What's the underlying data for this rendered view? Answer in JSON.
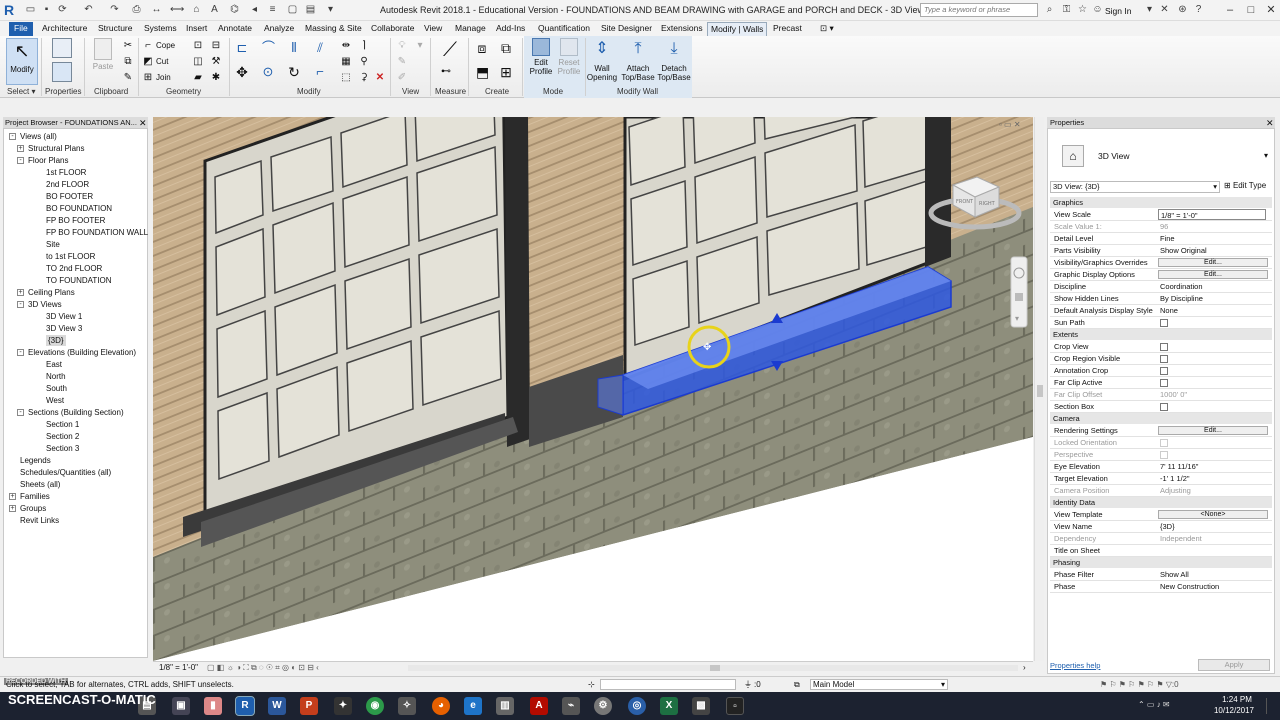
{
  "window": {
    "title": "Autodesk Revit 2018.1 - Educational Version -    FOUNDATIONS AND BEAM DRAWING with GARAGE and PORCH and DECK - 3D View: {3D}",
    "search_placeholder": "Type a keyword or phrase",
    "sign_in": "Sign In"
  },
  "menu_tabs": [
    "File",
    "Architecture",
    "Structure",
    "Systems",
    "Insert",
    "Annotate",
    "Analyze",
    "Massing & Site",
    "Collaborate",
    "View",
    "Manage",
    "Add-Ins",
    "Quantification",
    "Site Designer",
    "Extensions",
    "Modify | Walls",
    "Precast"
  ],
  "ribbon": {
    "modify": "Modify",
    "select": "Select",
    "properties": "Properties",
    "clipboard": "Clipboard",
    "paste": "Paste",
    "cope": "Cope",
    "cut": "Cut",
    "join": "Join",
    "geometry": "Geometry",
    "modify_panel": "Modify",
    "view": "View",
    "measure": "Measure",
    "create": "Create",
    "edit_profile_1": "Edit",
    "edit_profile_2": "Profile",
    "reset_profile_1": "Reset",
    "reset_profile_2": "Profile",
    "mode": "Mode",
    "wall_opening_1": "Wall",
    "wall_opening_2": "Opening",
    "attach_1": "Attach",
    "attach_2": "Top/Base",
    "detach_1": "Detach",
    "detach_2": "Top/Base",
    "modify_wall": "Modify Wall"
  },
  "project_browser": {
    "header": "Project Browser - FOUNDATIONS AN...",
    "items": [
      {
        "label": "Views (all)",
        "level": 0,
        "toggle": "-"
      },
      {
        "label": "Structural Plans",
        "level": 1,
        "toggle": "+"
      },
      {
        "label": "Floor Plans",
        "level": 1,
        "toggle": "-"
      },
      {
        "label": "1st FLOOR",
        "level": 2,
        "toggle": ""
      },
      {
        "label": "2nd FLOOR",
        "level": 2,
        "toggle": ""
      },
      {
        "label": "BO FOOTER",
        "level": 2,
        "toggle": ""
      },
      {
        "label": "BO FOUNDATION",
        "level": 2,
        "toggle": ""
      },
      {
        "label": "FP BO FOOTER",
        "level": 2,
        "toggle": ""
      },
      {
        "label": "FP BO FOUNDATION WALL",
        "level": 2,
        "toggle": ""
      },
      {
        "label": "Site",
        "level": 2,
        "toggle": ""
      },
      {
        "label": "to 1st FLOOR",
        "level": 2,
        "toggle": ""
      },
      {
        "label": "TO 2nd FLOOR",
        "level": 2,
        "toggle": ""
      },
      {
        "label": "TO FOUNDATION",
        "level": 2,
        "toggle": ""
      },
      {
        "label": "Ceiling Plans",
        "level": 1,
        "toggle": "+"
      },
      {
        "label": "3D Views",
        "level": 1,
        "toggle": "-"
      },
      {
        "label": "3D View 1",
        "level": 2,
        "toggle": ""
      },
      {
        "label": "3D View 3",
        "level": 2,
        "toggle": ""
      },
      {
        "label": "{3D}",
        "level": 2,
        "toggle": "",
        "selected": true
      },
      {
        "label": "Elevations (Building Elevation)",
        "level": 1,
        "toggle": "-"
      },
      {
        "label": "East",
        "level": 2,
        "toggle": ""
      },
      {
        "label": "North",
        "level": 2,
        "toggle": ""
      },
      {
        "label": "South",
        "level": 2,
        "toggle": ""
      },
      {
        "label": "West",
        "level": 2,
        "toggle": ""
      },
      {
        "label": "Sections (Building Section)",
        "level": 1,
        "toggle": "-"
      },
      {
        "label": "Section 1",
        "level": 2,
        "toggle": ""
      },
      {
        "label": "Section 2",
        "level": 2,
        "toggle": ""
      },
      {
        "label": "Section 3",
        "level": 2,
        "toggle": ""
      },
      {
        "label": "Legends",
        "level": 0,
        "toggle": ""
      },
      {
        "label": "Schedules/Quantities (all)",
        "level": 0,
        "toggle": ""
      },
      {
        "label": "Sheets (all)",
        "level": 0,
        "toggle": ""
      },
      {
        "label": "Families",
        "level": 0,
        "toggle": "+"
      },
      {
        "label": "Groups",
        "level": 0,
        "toggle": "+"
      },
      {
        "label": "Revit Links",
        "level": 0,
        "toggle": ""
      }
    ]
  },
  "properties": {
    "header": "Properties",
    "type_name": "3D View",
    "selector": "3D View: {3D}",
    "edit_type": "Edit Type",
    "help_link": "Properties help",
    "apply": "Apply",
    "groups": [
      {
        "name": "Graphics",
        "rows": [
          {
            "label": "View Scale",
            "value": "1/8\" = 1'-0\"",
            "kind": "input"
          },
          {
            "label": "Scale Value    1:",
            "value": "96",
            "kind": "grey"
          },
          {
            "label": "Detail Level",
            "value": "Fine"
          },
          {
            "label": "Parts Visibility",
            "value": "Show Original"
          },
          {
            "label": "Visibility/Graphics Overrides",
            "value": "Edit...",
            "kind": "button"
          },
          {
            "label": "Graphic Display Options",
            "value": "Edit...",
            "kind": "button"
          },
          {
            "label": "Discipline",
            "value": "Coordination"
          },
          {
            "label": "Show Hidden Lines",
            "value": "By Discipline"
          },
          {
            "label": "Default Analysis Display Style",
            "value": "None"
          },
          {
            "label": "Sun Path",
            "value": "",
            "kind": "check"
          }
        ]
      },
      {
        "name": "Extents",
        "rows": [
          {
            "label": "Crop View",
            "value": "",
            "kind": "check"
          },
          {
            "label": "Crop Region Visible",
            "value": "",
            "kind": "check"
          },
          {
            "label": "Annotation Crop",
            "value": "",
            "kind": "check"
          },
          {
            "label": "Far Clip Active",
            "value": "",
            "kind": "check"
          },
          {
            "label": "Far Clip Offset",
            "value": "1000' 0\"",
            "kind": "grey"
          },
          {
            "label": "Section Box",
            "value": "",
            "kind": "check"
          }
        ]
      },
      {
        "name": "Camera",
        "rows": [
          {
            "label": "Rendering Settings",
            "value": "Edit...",
            "kind": "button"
          },
          {
            "label": "Locked Orientation",
            "value": "",
            "kind": "greycheck"
          },
          {
            "label": "Perspective",
            "value": "",
            "kind": "greycheck"
          },
          {
            "label": "Eye Elevation",
            "value": "7'  11 11/16\""
          },
          {
            "label": "Target Elevation",
            "value": "-1'  1 1/2\""
          },
          {
            "label": "Camera Position",
            "value": "Adjusting",
            "kind": "grey"
          }
        ]
      },
      {
        "name": "Identity Data",
        "rows": [
          {
            "label": "View Template",
            "value": "<None>",
            "kind": "button"
          },
          {
            "label": "View Name",
            "value": "{3D}"
          },
          {
            "label": "Dependency",
            "value": "Independent",
            "kind": "grey"
          },
          {
            "label": "Title on Sheet",
            "value": ""
          }
        ]
      },
      {
        "name": "Phasing",
        "rows": [
          {
            "label": "Phase Filter",
            "value": "Show All"
          },
          {
            "label": "Phase",
            "value": "New Construction"
          }
        ]
      }
    ]
  },
  "view_control": {
    "scale": "1/8\" = 1'-0\""
  },
  "status": {
    "message": "Click to select, TAB for alternates, CTRL adds, SHIFT unselects.",
    "zero": ":0",
    "workset": "Main Model"
  },
  "overlay": {
    "recorded_with": "RECORDED WITH",
    "brand": "SCREENCAST-O-MATIC"
  },
  "clock": {
    "time": "1:24 PM",
    "date": "10/12/2017"
  },
  "taskbar_icons": [
    "word-icon",
    "powerpoint-icon",
    "chrome-icon",
    "firefox-icon",
    "excel-icon",
    "revit-icon"
  ]
}
